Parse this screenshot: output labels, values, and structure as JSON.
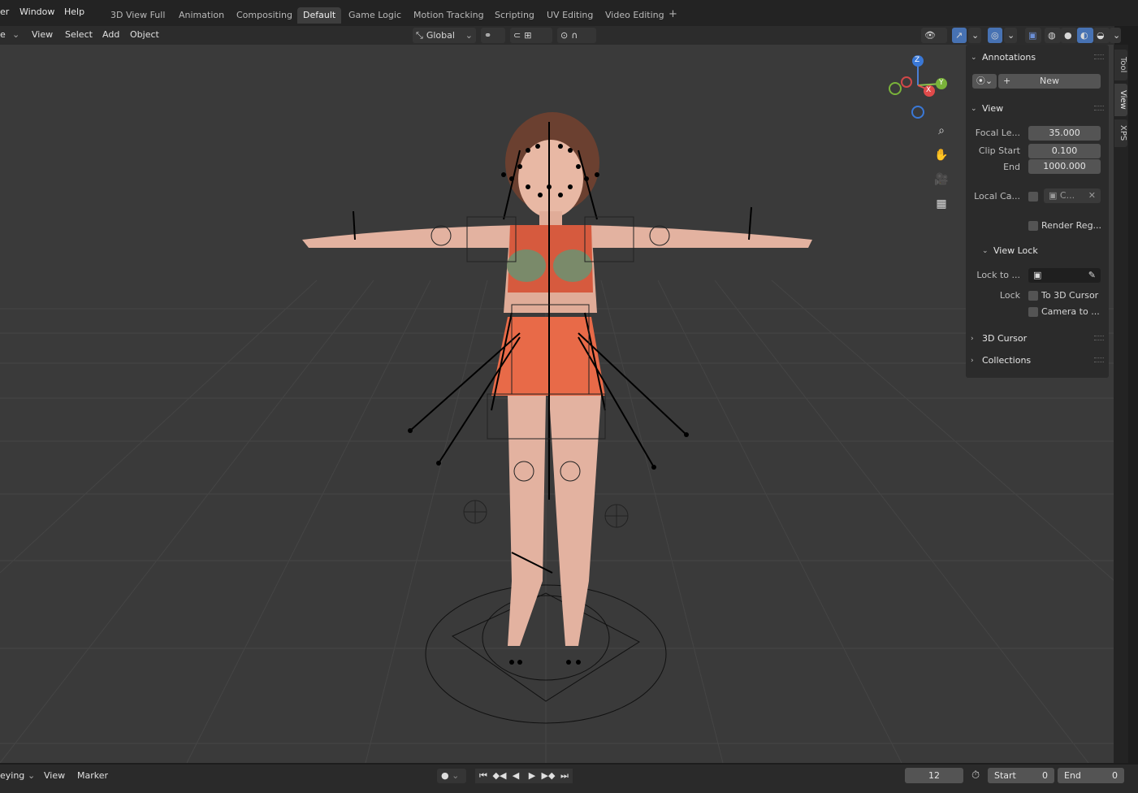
{
  "topbar": {
    "menus": [
      "er",
      "Window",
      "Help"
    ],
    "workspaces": [
      "3D View Full",
      "Animation",
      "Compositing",
      "Default",
      "Game Logic",
      "Motion Tracking",
      "Scripting",
      "UV Editing",
      "Video Editing"
    ],
    "active_workspace": "Default",
    "add_tab": "+"
  },
  "viewport_header": {
    "mode_label": "e",
    "menus": [
      "View",
      "Select",
      "Add",
      "Object"
    ],
    "transform_orientation": "Global"
  },
  "gizmo": {
    "z": "Z",
    "y": "Y",
    "x": "X"
  },
  "sidebar": {
    "annotations": {
      "title": "Annotations",
      "new_label": "New"
    },
    "view": {
      "title": "View",
      "focal_label": "Focal Le...",
      "focal_value": "35.000",
      "clip_start_label": "Clip Start",
      "clip_start_value": "0.100",
      "end_label": "End",
      "end_value": "1000.000",
      "local_camera_label": "Local Ca...",
      "local_camera_value": "C...",
      "render_region_label": "Render Reg..."
    },
    "view_lock": {
      "title": "View Lock",
      "lock_to_label": "Lock to ...",
      "lock_label": "Lock",
      "to_3d_cursor": "To 3D Cursor",
      "camera_to": "Camera to ..."
    },
    "cursor_3d": "3D Cursor",
    "collections": "Collections"
  },
  "vertical_tabs": [
    "Tool",
    "View",
    "XPS"
  ],
  "timeline": {
    "mode": "eying",
    "menus": [
      "View",
      "Marker"
    ],
    "current_frame": "12",
    "start_label": "Start",
    "start_value": "0",
    "end_label": "End",
    "end_value": "0"
  }
}
